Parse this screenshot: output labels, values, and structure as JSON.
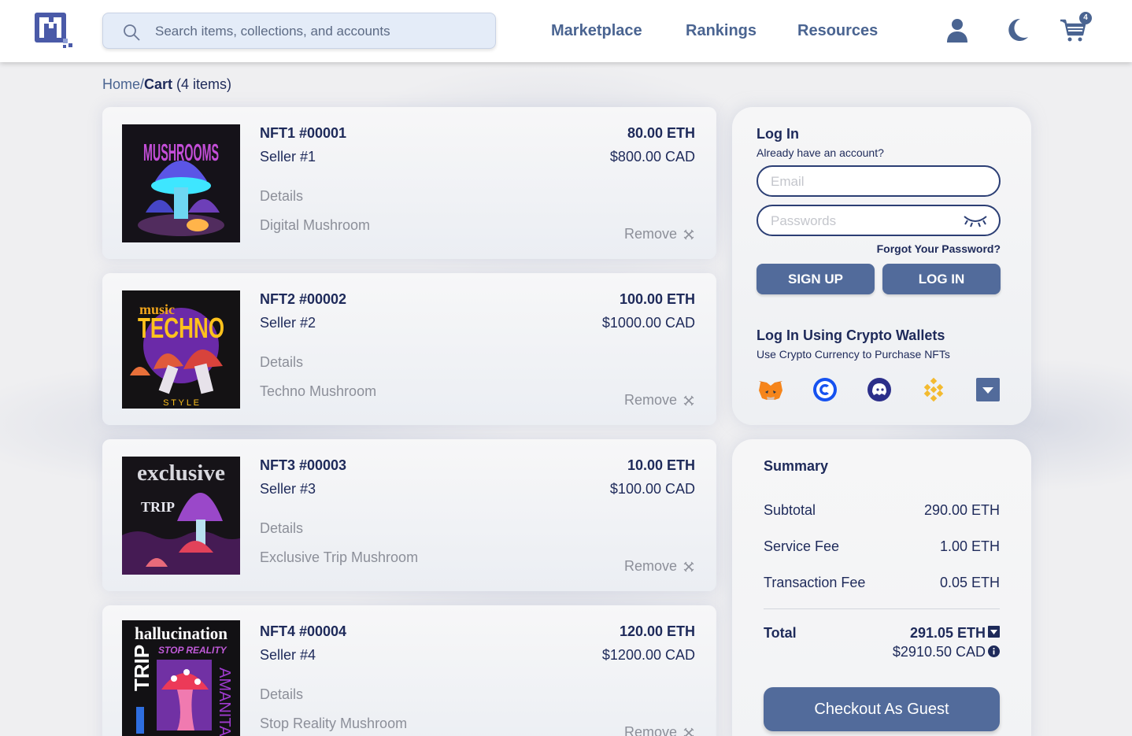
{
  "header": {
    "search_placeholder": "Search items, collections, and accounts",
    "nav": [
      "Marketplace",
      "Rankings",
      "Resources"
    ],
    "cart_count": "4"
  },
  "breadcrumb": {
    "home": "Home/",
    "current": "Cart",
    "count": " (4 items)"
  },
  "cart_items": [
    {
      "name": "NFT1 #00001",
      "seller": "Seller #1",
      "details_label": "Details",
      "description": "Digital Mushroom",
      "eth": "80.00 ETH",
      "cad": "$800.00 CAD",
      "remove_label": "Remove",
      "art_text": "MUSHROOMS"
    },
    {
      "name": "NFT2 #00002",
      "seller": "Seller #2",
      "details_label": "Details",
      "description": "Techno Mushroom",
      "eth": "100.00 ETH",
      "cad": "$1000.00 CAD",
      "remove_label": "Remove",
      "art_text": "TECHNO",
      "art_text_2": "music",
      "art_text_3": "S T Y L E"
    },
    {
      "name": "NFT3 #00003",
      "seller": "Seller #3",
      "details_label": "Details",
      "description": "Exclusive Trip Mushroom",
      "eth": "10.00 ETH",
      "cad": "$100.00 CAD",
      "remove_label": "Remove",
      "art_text": "exclusive",
      "art_text_2": "TRIP"
    },
    {
      "name": "NFT4 #00004",
      "seller": "Seller #4",
      "details_label": "Details",
      "description": "Stop Reality Mushroom",
      "eth": "120.00 ETH",
      "cad": "$1200.00 CAD",
      "remove_label": "Remove",
      "art_text": "hallucination",
      "art_text_2": "STOP REALITY",
      "art_text_3": "TRIP",
      "art_text_4": "AMANITA"
    }
  ],
  "login": {
    "title": "Log In",
    "subtitle": "Already have an account?",
    "email_placeholder": "Email",
    "password_placeholder": "Passwords",
    "forgot": "Forgot Your Password?",
    "signup_label": "SIGN UP",
    "login_label": "LOG IN",
    "wallet_title": "Log In Using Crypto Wallets",
    "wallet_subtitle": "Use Crypto Currency to Purchase NFTs",
    "wallets": [
      "metamask-icon",
      "coinbase-icon",
      "wallet-ghost-icon",
      "binance-icon",
      "more-wallets-icon"
    ]
  },
  "summary": {
    "title": "Summary",
    "rows": [
      {
        "label": "Subtotal",
        "value": "290.00 ETH"
      },
      {
        "label": "Service Fee",
        "value": "1.00 ETH"
      },
      {
        "label": "Transaction Fee",
        "value": "0.05 ETH"
      }
    ],
    "total_label": "Total",
    "total_eth": "291.05 ETH",
    "total_cad": "$2910.50 CAD",
    "checkout_label": "Checkout As Guest"
  },
  "colors": {
    "accent": "#526b9b",
    "navy": "#1e2a5a",
    "muted": "#8c8f99"
  }
}
